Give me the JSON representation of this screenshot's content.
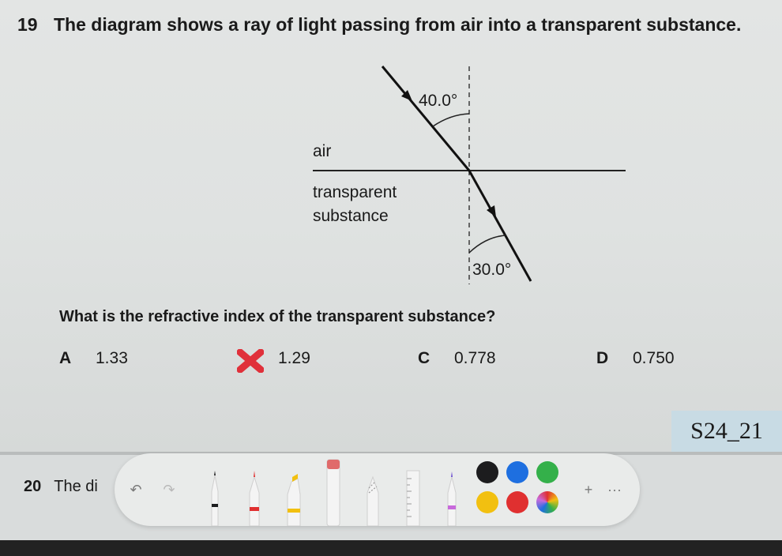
{
  "question": {
    "number": "19",
    "text": "The diagram shows a ray of light passing from air into a transparent substance.",
    "diagram": {
      "angle_incidence": "40.0°",
      "angle_refraction": "30.0°",
      "medium_top": "air",
      "medium_bottom_line1": "transparent",
      "medium_bottom_line2": "substance"
    },
    "prompt": "What is the refractive index of the transparent substance?",
    "options": [
      {
        "letter": "A",
        "value": "1.33"
      },
      {
        "letter": "B",
        "value": "1.29"
      },
      {
        "letter": "C",
        "value": "0.778"
      },
      {
        "letter": "D",
        "value": "0.750"
      }
    ],
    "selected_marked": "B"
  },
  "code_tag": "S24_21",
  "next_question": {
    "number": "20",
    "text": "The di"
  },
  "toolbar": {
    "undo_icon": "undo-icon",
    "redo_icon": "redo-icon",
    "add_label": "+",
    "more_label": "···",
    "colors": [
      "#1c1c1e",
      "#1e6fe0",
      "#34b04a",
      "#f2c010",
      "#e03030",
      "#c86adb"
    ]
  }
}
